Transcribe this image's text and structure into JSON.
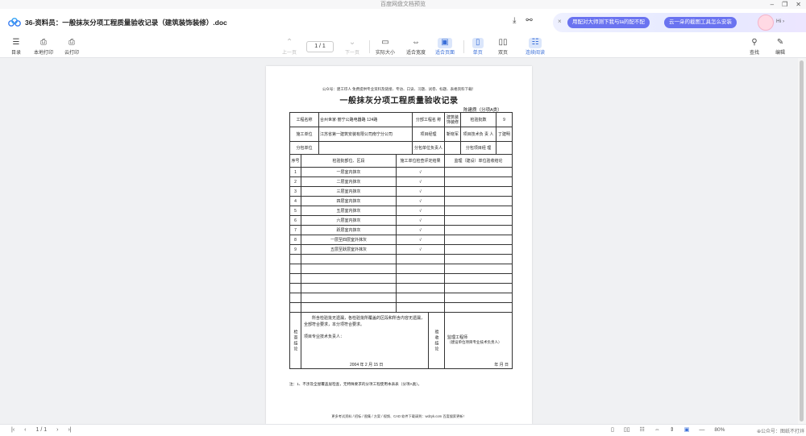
{
  "window": {
    "title": "百度网盘文档预览",
    "controls": [
      "–",
      "❐",
      "✕"
    ]
  },
  "doc": {
    "title": "36-资料员：一般抹灰分项工程质量验收记录（建筑装饰装修）.doc",
    "download_icon": "download-icon",
    "share_icon": "share-icon"
  },
  "ai": {
    "close": "×",
    "chip1": "用配对大师测下我与ta的配不配",
    "chip2": "云一朵的截图工具怎么安装",
    "hi": "Hi ›"
  },
  "toolbar": {
    "toc": "目录",
    "local_print": "本地打印",
    "cloud_print": "云打印",
    "prev": "上一页",
    "page": "1 / 1",
    "next": "下一页",
    "actual": "实际大小",
    "fit_width": "适合宽度",
    "fit_page": "适合页面",
    "single": "单页",
    "double": "双页",
    "continuous": "连续阅读",
    "search": "查找",
    "edit": "编辑"
  },
  "page": {
    "header": "公众号：建工印人  免费提供专业资料及链接、专访、口诀、习题、试卷、标题、表格资料下载！",
    "title": "一般抹灰分项工程质量验收记录",
    "code": "陈建质（分项A类）",
    "labels": {
      "project_name": "工程名称",
      "sub_project": "分部工程名   称",
      "sub_project_val": "建筑装饰装修",
      "lot_count": "检验批数",
      "contractor": "施工单位",
      "project_mgr": "项目经理",
      "tech_lead": "项目技术负   责   人",
      "subcontractor": "分包单位",
      "sub_lead": "分包单位负责人",
      "sub_mgr": "分包项目经   理",
      "seq": "序号",
      "part": "检验批部位、区段",
      "result": "施工单位检查评定结果",
      "supervisor": "监理（建设）单位验收结论"
    },
    "values": {
      "project_name": "合州世家·丽宁公路电器路 124路",
      "lot_count": "9",
      "contractor": "江苏省第一建筑安装有限公司南宁分公司",
      "project_mgr": "靳晓军",
      "tech_lead": "丁建明"
    },
    "rows": [
      {
        "no": "1",
        "part": "一层室内抹灰",
        "result": "√"
      },
      {
        "no": "2",
        "part": "二层室内抹灰",
        "result": "√"
      },
      {
        "no": "3",
        "part": "三层室内抹灰",
        "result": "√"
      },
      {
        "no": "4",
        "part": "四层室内抹灰",
        "result": "√"
      },
      {
        "no": "5",
        "part": "五层室内抹灰",
        "result": "√"
      },
      {
        "no": "6",
        "part": "六层室内抹灰",
        "result": "√"
      },
      {
        "no": "7",
        "part": "跃层室内抹灰",
        "result": "√"
      },
      {
        "no": "8",
        "part": "一层至四层室外抹灰",
        "result": "√"
      },
      {
        "no": "9",
        "part": "五层至跃层室外抹灰",
        "result": "√"
      }
    ],
    "check_label": "检查结论",
    "check_text": "所含检验批无遗漏，各检验批所覆盖的区段和所含内容无遗漏，全部符合要求，本分项符合要求。",
    "check_sign": "项目专业技术负责人：",
    "check_date": "2004 年 2 月 15 日",
    "accept_label": "验收结论",
    "accept_sign": "监理工程师",
    "accept_sub": "（建设单位项目专业技术负责人）",
    "accept_date": "年    月    日",
    "note": "注：1、不涉及全屋覆盖层检查，无特殊要求的分项工程使用本表表（分项A类）。",
    "footer": "更多考试资料 / 招标 / 图集 / 方案 / 视频、CAD 软件下载请到：wdzyk.com  百度搜索更新！"
  },
  "status": {
    "page": "1 / 1",
    "zoom": "80%",
    "watermark": "⊕公众号：图纸不打烊"
  }
}
